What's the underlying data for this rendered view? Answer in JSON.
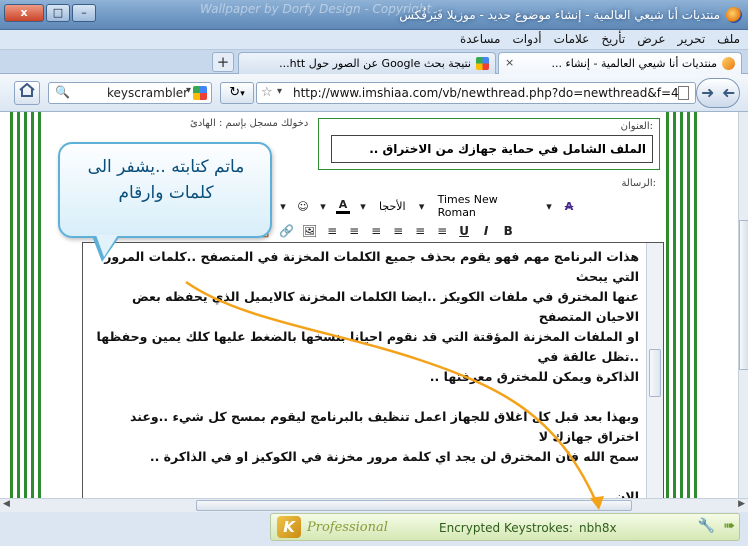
{
  "window": {
    "title": "منتديات أنا شيعي العالمية - إنشاء موضوع جديد - موزيلا فَيَرفُكس",
    "banner": "Wallpaper by Dorfy Design - Copyright",
    "close_label": "x",
    "max_label": "□",
    "min_label": "–"
  },
  "menu": [
    "ملف",
    "تحرير",
    "عرض",
    "تأريخ",
    "علامات",
    "أدوات",
    "مساعدة"
  ],
  "tabs": [
    {
      "label": "منتديات أنا شيعي العالمية - إنشاء ...",
      "active": true
    },
    {
      "label": "نتيجة بحث Google عن الصور حول htt...",
      "active": false
    }
  ],
  "newtab_label": "+",
  "tab_close_label": "×",
  "search": {
    "value": "keyscrambler"
  },
  "address": {
    "url": "http://www.imshiaa.com/vb/newthread.php?do=newthread&f=43"
  },
  "page": {
    "login_text": "دخولك مسجل بإسم : الهادئ",
    "title_label": "العنوان:",
    "title_value": "الملف الشامل في حماية جهازك من الاختراق ..",
    "message_label": "الرسالة:"
  },
  "editor_toolbar": {
    "font_name": "Times New Roman",
    "font_size": "الأحجا"
  },
  "editor_text": "هذات البرنامج مهم فهو يقوم بحذف جميع الكلمات المخزنة في المتصفح ..كلمات المرور التي يبحث\nعنها المخترق في ملفات الكويكز ..ايضا الكلمات المخزنة كالايميل الذي يحفظه بعض الاحيان المتصفح\nاو الملفات المخزنة المؤقتة التي قد نقوم احيانا بنسخها بالضغط عليها كلك يمين وحفظها ..تظل عالقة في\nالذاكرة ويمكن للمخترق معرفتها ..\n\nوبهذا بعد قبل كل اغلاق للجهاز اعمل تنظيف بالبرنامج ليقوم بمسح كل شيء ..وعند اختراق جهازك لا\nسمح الله فان المخترق لن يجد اي كلمة مرور مخزنة في الكوكيز او في الذاكرة ..\n\nالان",
  "callout_text": "ماتم كتابته ..يشفر الى كلمات وارقام",
  "keyscrambler": {
    "logo_letter": "K",
    "edition": "Professional",
    "label": "Encrypted Keystrokes:",
    "value": "nbh8x"
  },
  "colors": {
    "accent_green": "#2e8b2e",
    "callout_border": "#5fb0d8",
    "arrow_orange": "#f4a21a"
  }
}
